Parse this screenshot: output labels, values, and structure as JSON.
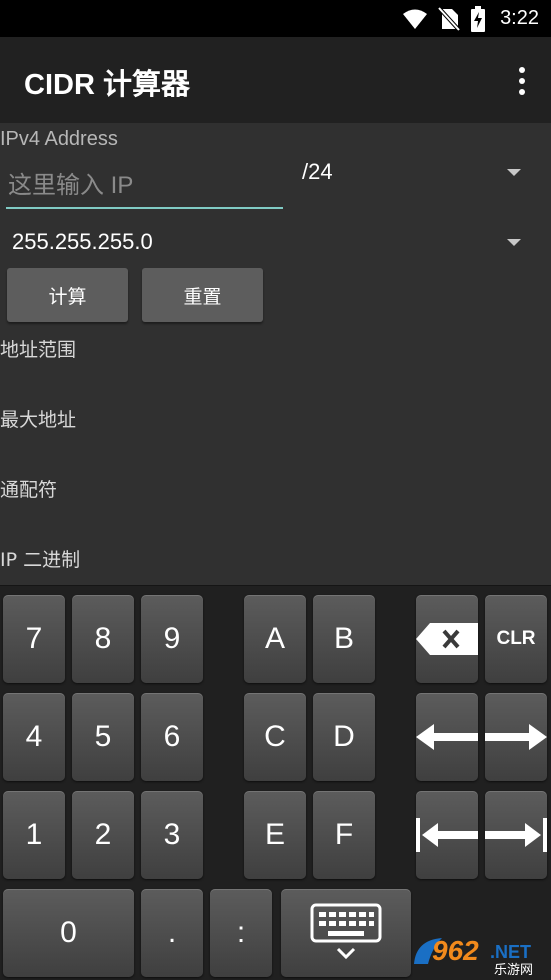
{
  "status_bar": {
    "time": "3:22",
    "icons": [
      "wifi-icon",
      "no-sim-icon",
      "battery-charging-icon"
    ]
  },
  "app_bar": {
    "title": "CIDR 计算器",
    "overflow_icon": "more-vert-icon"
  },
  "form": {
    "ipv4_label": "IPv4 Address",
    "ip_input": {
      "value": "",
      "placeholder": "这里输入 IP"
    },
    "prefix_select": {
      "selected": "/24"
    },
    "mask_select": {
      "selected": "255.255.255.0"
    },
    "calculate_button": "计算",
    "reset_button": "重置"
  },
  "results": [
    {
      "label": "地址范围"
    },
    {
      "label": "最大地址"
    },
    {
      "label": "通配符"
    },
    {
      "label": "IP 二进制"
    }
  ],
  "keypad": {
    "keys": [
      "7",
      "8",
      "9",
      "A",
      "B",
      "4",
      "5",
      "6",
      "C",
      "D",
      "1",
      "2",
      "3",
      "E",
      "F",
      "0",
      ".",
      ":"
    ],
    "clear_label": "CLR",
    "special_icons": [
      "backspace-icon",
      "cursor-left-icon",
      "cursor-right-icon",
      "cursor-home-icon",
      "cursor-end-icon",
      "keyboard-hide-icon"
    ]
  },
  "watermark": {
    "text": "962.NET",
    "subtext": "乐游网"
  },
  "colors": {
    "app_bar": "#212121",
    "background": "#303030",
    "accent": "#80cbc4",
    "button": "#5d5d5d",
    "keypad": "#202020",
    "watermark_orange": "#f28a1c",
    "watermark_blue": "#1a6fc4"
  }
}
